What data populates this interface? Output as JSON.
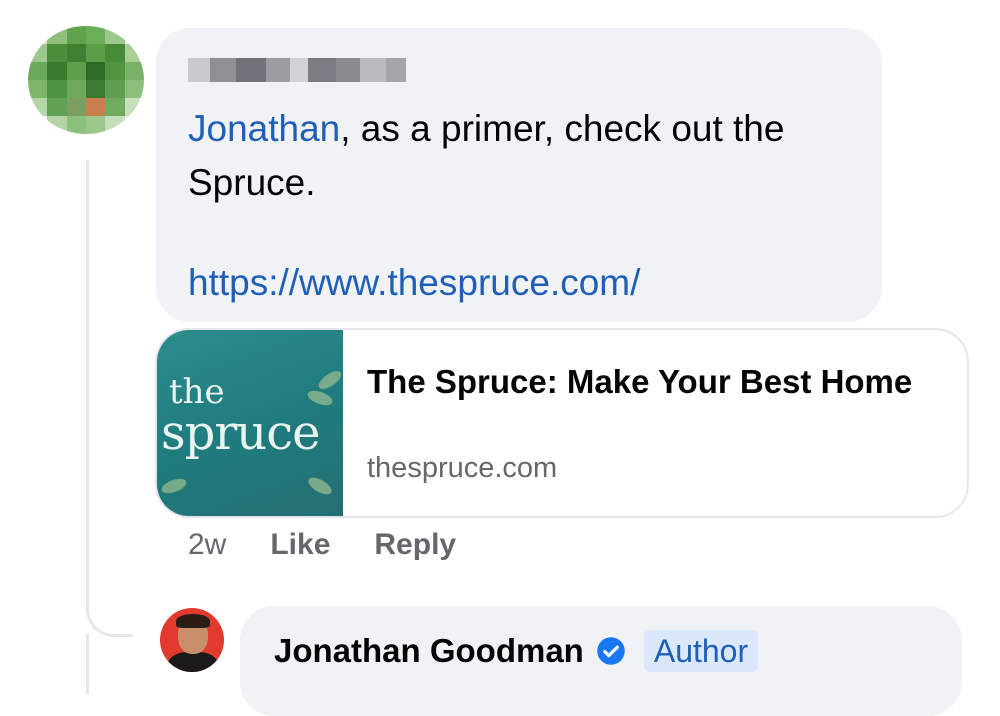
{
  "comment": {
    "mention": "Jonathan",
    "text_after_mention": ", as a primer, check out the Spruce.",
    "link": "https://www.thespruce.com/"
  },
  "link_preview": {
    "thumb_line1": "the",
    "thumb_line2": "spruce",
    "title": "The Spruce: Make Your Best Home",
    "domain": "thespruce.com"
  },
  "actions": {
    "timestamp": "2w",
    "like_label": "Like",
    "reply_label": "Reply"
  },
  "reply": {
    "author_name": "Jonathan Goodman",
    "badge": "Author",
    "verified_icon": "verified-check-icon"
  },
  "colors": {
    "link": "#1f5fb8",
    "bubble": "#f0f2f5",
    "muted": "#65676b"
  }
}
